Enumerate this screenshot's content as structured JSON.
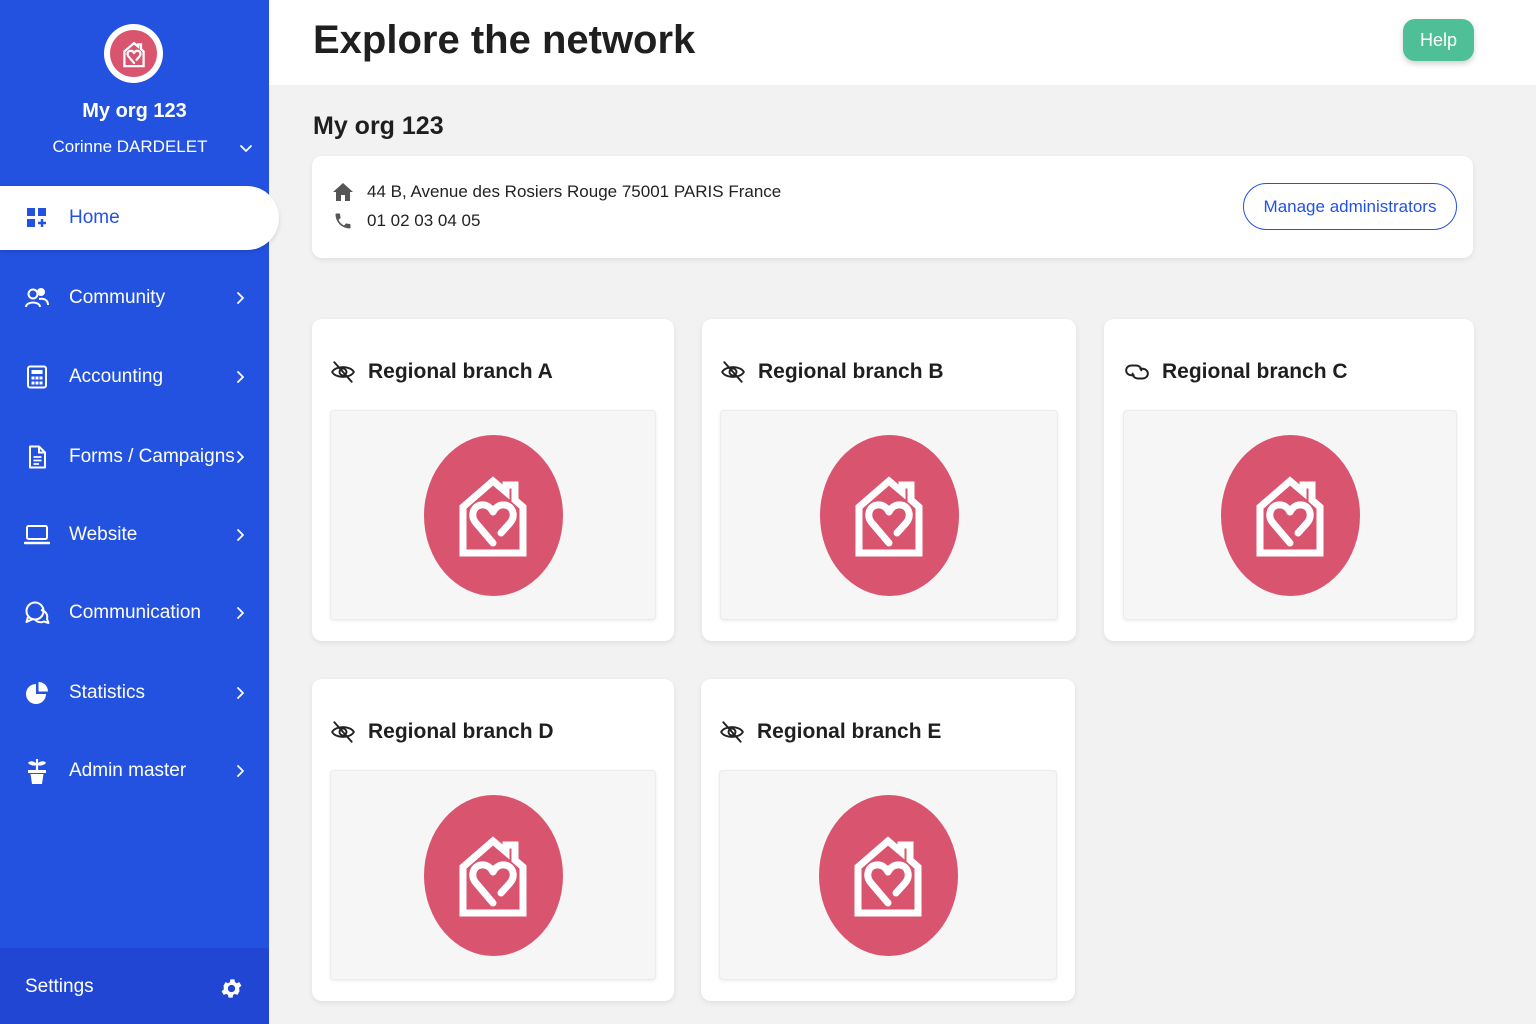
{
  "sidebar": {
    "org_name": "My org 123",
    "user_name": "Corinne DARDELET",
    "items": [
      {
        "label": "Home",
        "icon": "dashboard-icon",
        "active": true
      },
      {
        "label": "Community",
        "icon": "users-icon"
      },
      {
        "label": "Accounting",
        "icon": "calculator-icon"
      },
      {
        "label": "Forms / Campaigns",
        "icon": "document-icon"
      },
      {
        "label": "Website",
        "icon": "laptop-icon"
      },
      {
        "label": "Communication",
        "icon": "chat-bubbles-icon"
      },
      {
        "label": "Statistics",
        "icon": "pie-chart-icon"
      },
      {
        "label": "Admin master",
        "icon": "plant-icon"
      }
    ],
    "settings_label": "Settings"
  },
  "header": {
    "title": "Explore the network",
    "help_label": "Help"
  },
  "main": {
    "section_title": "My org 123",
    "address": "44 B, Avenue des Rosiers Rouge 75001 PARIS France",
    "phone": "01 02 03 04 05",
    "manage_label": "Manage administrators",
    "branches": [
      {
        "name": "Regional branch A",
        "icon": "eye-off-icon"
      },
      {
        "name": "Regional branch B",
        "icon": "eye-off-icon"
      },
      {
        "name": "Regional branch C",
        "icon": "link-icon"
      },
      {
        "name": "Regional branch D",
        "icon": "eye-off-icon"
      },
      {
        "name": "Regional branch E",
        "icon": "eye-off-icon"
      }
    ]
  },
  "colors": {
    "sidebar": "#2352e0",
    "accent": "#2352e0",
    "help": "#4fbf97",
    "logo": "#d9546e"
  }
}
